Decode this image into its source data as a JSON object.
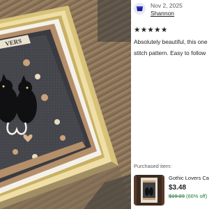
{
  "review": {
    "date": "Nov 2, 2025",
    "reviewer": "Shannon",
    "stars": "★★★★★",
    "text_line1": "Absolutely beautiful, this one",
    "text_line2": "stitch pattern. Easy to follow"
  },
  "purchased": {
    "label": "Purchased item:",
    "title": "Gothic Lovers Ca",
    "price": "$3.48",
    "original_price": "$10.23",
    "discount": "(66% off)"
  },
  "colors": {
    "price_discount": "#1f7a35",
    "avatar_bg": "#e6e8f6",
    "avatar_icon": "#1b1f8f"
  }
}
